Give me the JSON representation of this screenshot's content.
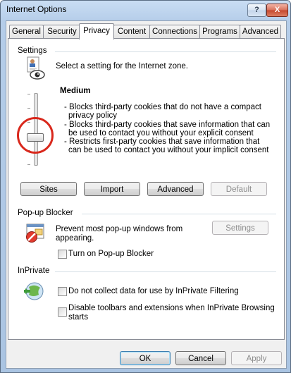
{
  "window": {
    "title": "Internet Options",
    "help_glyph": "?",
    "close_glyph": "X"
  },
  "tabs": [
    {
      "label": "General"
    },
    {
      "label": "Security"
    },
    {
      "label": "Privacy"
    },
    {
      "label": "Content"
    },
    {
      "label": "Connections"
    },
    {
      "label": "Programs"
    },
    {
      "label": "Advanced"
    }
  ],
  "active_tab": "Privacy",
  "settings": {
    "heading": "Settings",
    "prompt": "Select a setting for the Internet zone.",
    "level": "Medium",
    "lines": [
      "- Blocks third-party cookies that do not have a compact",
      "privacy policy",
      "- Blocks third-party cookies that save information that can",
      "be used to contact you without your explicit consent",
      "- Restricts first-party cookies that save information that",
      "can be used to contact you without your implicit consent"
    ],
    "slider_icon": "privacy-slider-handle",
    "buttons": {
      "sites": "Sites",
      "import": "Import",
      "advanced": "Advanced",
      "default": "Default"
    }
  },
  "popup": {
    "heading": "Pop-up Blocker",
    "description_line1": "Prevent most pop-up windows from",
    "description_line2": "appearing.",
    "settings_button": "Settings",
    "turn_on_label": "Turn on Pop-up Blocker",
    "turn_on_checked": false
  },
  "inprivate": {
    "heading": "InPrivate",
    "filtering_label": "Do not collect data for use by InPrivate Filtering",
    "filtering_checked": false,
    "toolbars_line1": "Disable toolbars and extensions when InPrivate Browsing",
    "toolbars_line2": "starts",
    "toolbars_checked": false
  },
  "footer": {
    "ok": "OK",
    "cancel": "Cancel",
    "apply": "Apply"
  },
  "colors": {
    "highlight_ring": "#d9281c",
    "window_frame": "#aac4e2",
    "dialog_bg": "#f0f0f0"
  }
}
